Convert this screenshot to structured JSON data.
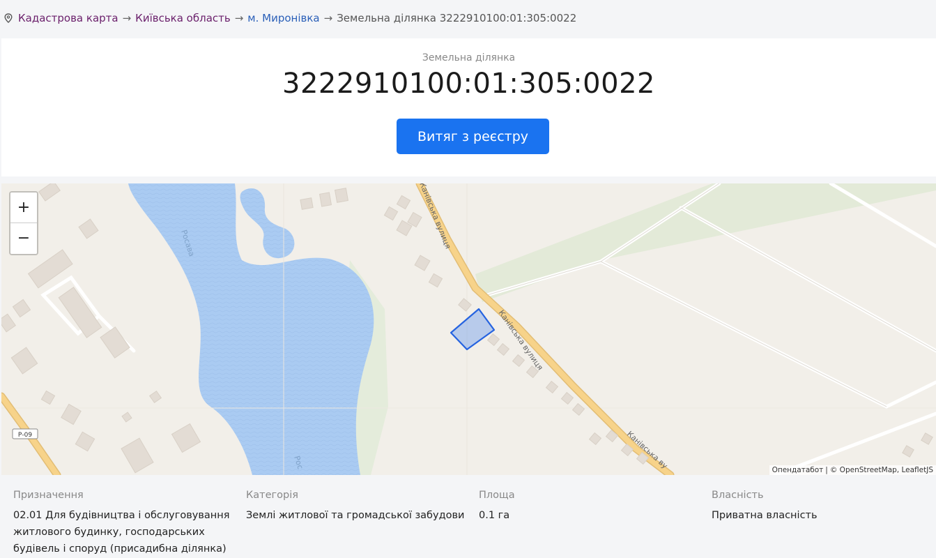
{
  "breadcrumb": {
    "items": [
      "Кадастрова карта",
      "Київська область",
      "м. Миронівка"
    ],
    "separator": "→",
    "current": "Земельна ділянка 3222910100:01:305:0022"
  },
  "header": {
    "subtitle": "Земельна ділянка",
    "cadastral_number": "3222910100:01:305:0022",
    "extract_button": "Витяг з реєстру"
  },
  "map": {
    "zoom_in": "+",
    "zoom_out": "−",
    "labels": {
      "river_top": "Росава",
      "river_bottom": "Рос",
      "street_top": "Канівська вулиця",
      "street_mid": "Канівська вулиця",
      "street_bottom": "Канівська ву",
      "road_badge": "Р-09"
    },
    "attribution": {
      "source": "Опендатабот",
      "osm": "© OpenStreetMap",
      "leaflet": "LeafletJS"
    },
    "colors": {
      "land": "#f2efe9",
      "water": "#aacbf2",
      "road": "#f7d38a",
      "parcel": "#3f7ef0"
    }
  },
  "info": {
    "purpose": {
      "label": "Призначення",
      "lines": [
        "02.01 Для будівництва і обслуговування",
        "житлового будинку, господарських",
        "будівель і споруд (присадибна ділянка)"
      ]
    },
    "category": {
      "label": "Категорія",
      "value": "Землі житлової та громадської забудови"
    },
    "area": {
      "label": "Площа",
      "value": "0.1 га"
    },
    "ownership": {
      "label": "Власність",
      "value": "Приватна власність"
    }
  }
}
